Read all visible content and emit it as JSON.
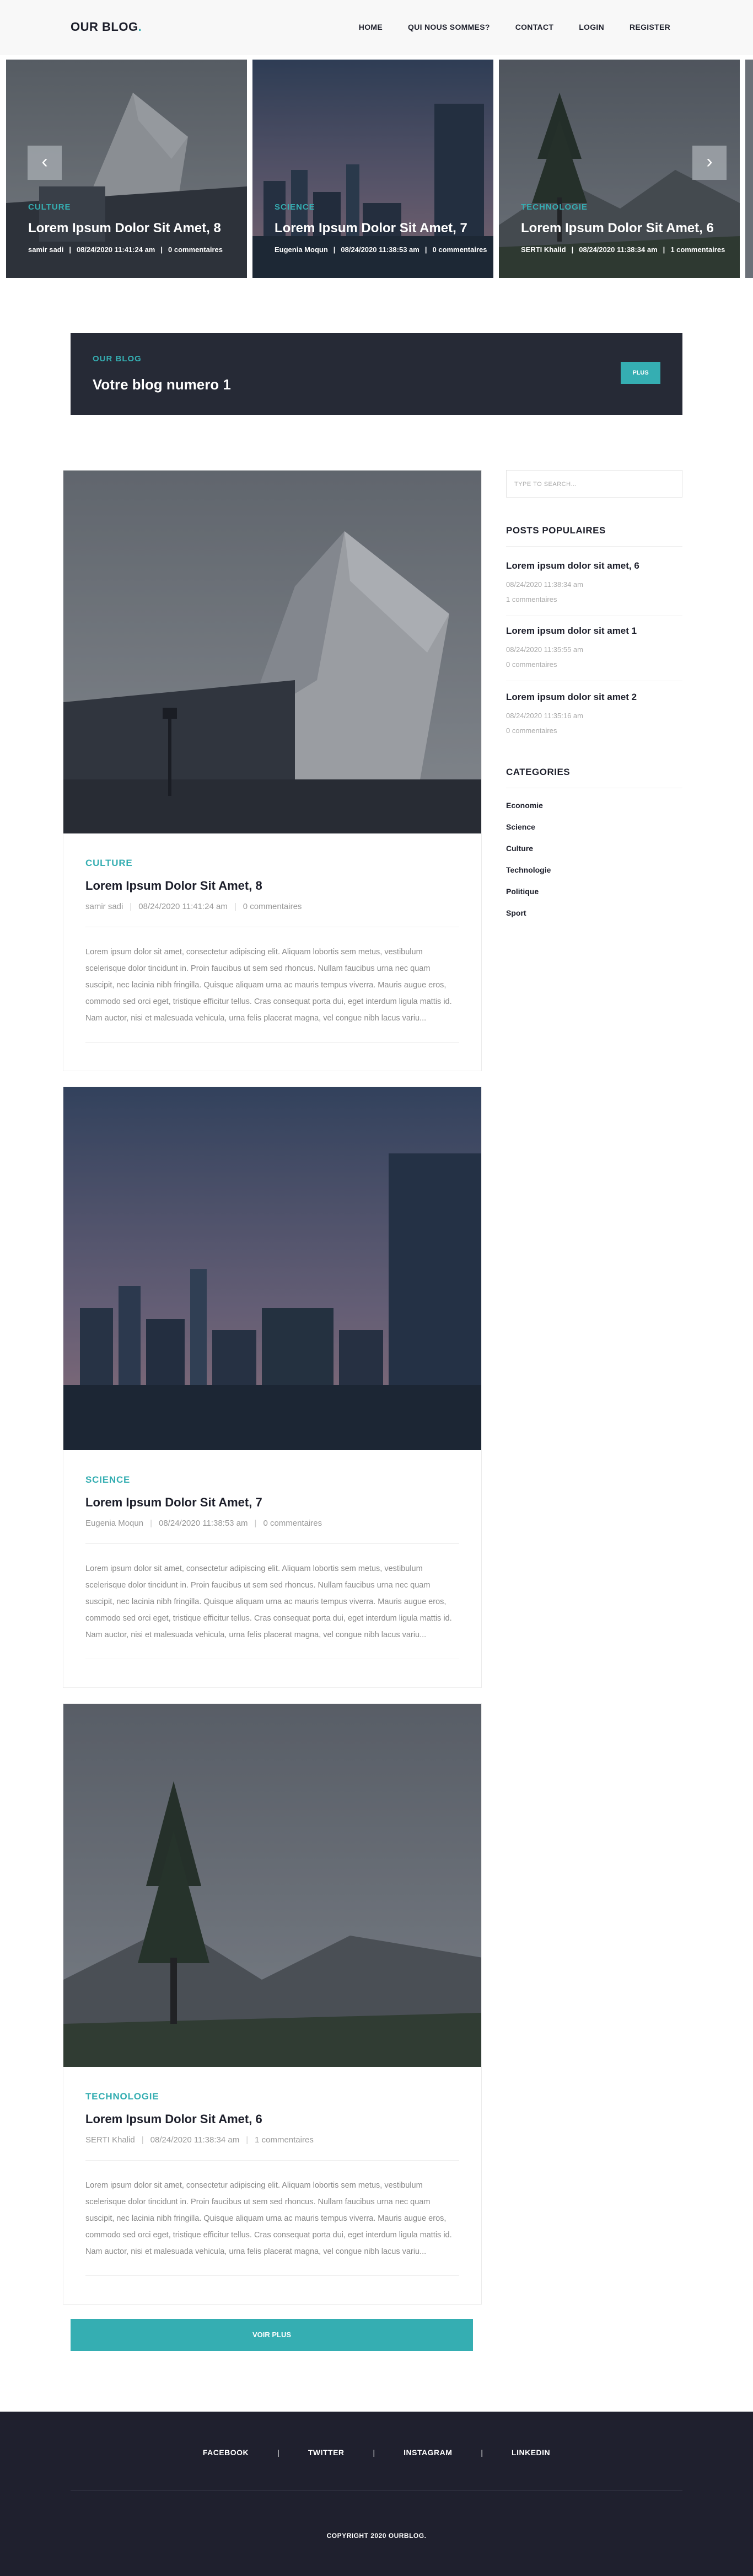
{
  "header": {
    "logo": "OUR BLOG",
    "logo_dot": ".",
    "nav": [
      "HOME",
      "QUI NOUS SOMMES?",
      "CONTACT",
      "LOGIN",
      "REGISTER"
    ]
  },
  "carousel": {
    "prev_icon": "‹",
    "next_icon": "›",
    "slides": [
      {
        "category": "CULTURE",
        "title": "Lorem Ipsum Dolor Sit Amet, 8",
        "author": "samir sadi",
        "date": "08/24/2020 11:41:24 am",
        "comments": "0 commentaires"
      },
      {
        "category": "SCIENCE",
        "title": "Lorem Ipsum Dolor Sit Amet, 7",
        "author": "Eugenia Moqun",
        "date": "08/24/2020 11:38:53 am",
        "comments": "0 commentaires"
      },
      {
        "category": "TECHNOLOGIE",
        "title": "Lorem Ipsum Dolor Sit Amet, 6",
        "author": "SERTI Khalid",
        "date": "08/24/2020 11:38:34 am",
        "comments": "1 commentaires"
      }
    ]
  },
  "banner": {
    "subtitle": "OUR BLOG",
    "title": "Votre blog numero 1",
    "button": "PLUS"
  },
  "posts": [
    {
      "category": "CULTURE",
      "title": "Lorem Ipsum Dolor Sit Amet, 8",
      "author": "samir sadi",
      "date": "08/24/2020 11:41:24 am",
      "comments": "0 commentaires",
      "excerpt": "Lorem ipsum dolor sit amet, consectetur adipiscing elit. Aliquam lobortis sem metus, vestibulum scelerisque dolor tincidunt in. Proin faucibus ut sem sed rhoncus. Nullam faucibus urna nec quam suscipit, nec lacinia nibh fringilla. Quisque aliquam urna ac mauris tempus viverra. Mauris augue eros, commodo sed orci eget, tristique efficitur tellus. Cras consequat porta dui, eget interdum ligula mattis id. Nam auctor, nisi et malesuada vehicula, urna felis placerat magna, vel congue nibh lacus variu..."
    },
    {
      "category": "SCIENCE",
      "title": "Lorem Ipsum Dolor Sit Amet, 7",
      "author": "Eugenia Moqun",
      "date": "08/24/2020 11:38:53 am",
      "comments": "0 commentaires",
      "excerpt": "Lorem ipsum dolor sit amet, consectetur adipiscing elit. Aliquam lobortis sem metus, vestibulum scelerisque dolor tincidunt in. Proin faucibus ut sem sed rhoncus. Nullam faucibus urna nec quam suscipit, nec lacinia nibh fringilla. Quisque aliquam urna ac mauris tempus viverra. Mauris augue eros, commodo sed orci eget, tristique efficitur tellus. Cras consequat porta dui, eget interdum ligula mattis id. Nam auctor, nisi et malesuada vehicula, urna felis placerat magna, vel congue nibh lacus variu..."
    },
    {
      "category": "TECHNOLOGIE",
      "title": "Lorem Ipsum Dolor Sit Amet, 6",
      "author": "SERTI Khalid",
      "date": "08/24/2020 11:38:34 am",
      "comments": "1 commentaires",
      "excerpt": "Lorem ipsum dolor sit amet, consectetur adipiscing elit. Aliquam lobortis sem metus, vestibulum scelerisque dolor tincidunt in. Proin faucibus ut sem sed rhoncus. Nullam faucibus urna nec quam suscipit, nec lacinia nibh fringilla. Quisque aliquam urna ac mauris tempus viverra. Mauris augue eros, commodo sed orci eget, tristique efficitur tellus. Cras consequat porta dui, eget interdum ligula mattis id. Nam auctor, nisi et malesuada vehicula, urna felis placerat magna, vel congue nibh lacus variu..."
    }
  ],
  "more_button": "VOIR PLUS",
  "sidebar": {
    "search_placeholder": "TYPE TO SEARCH...",
    "popular_heading": "POSTS POPULAIRES",
    "popular": [
      {
        "title": "Lorem ipsum dolor sit amet, 6",
        "date": "08/24/2020 11:38:34 am",
        "comments": "1 commentaires"
      },
      {
        "title": "Lorem ipsum dolor sit amet 1",
        "date": "08/24/2020 11:35:55 am",
        "comments": "0 commentaires"
      },
      {
        "title": "Lorem ipsum dolor sit amet 2",
        "date": "08/24/2020 11:35:16 am",
        "comments": "0 commentaires"
      }
    ],
    "categories_heading": "CATEGORIES",
    "categories": [
      "Economie",
      "Science",
      "Culture",
      "Technologie",
      "Politique",
      "Sport"
    ]
  },
  "footer": {
    "links": [
      "FACEBOOK",
      "TWITTER",
      "INSTAGRAM",
      "LINKEDIN"
    ],
    "separator": "|",
    "copyright": "COPYRIGHT 2020 OURBLOG."
  },
  "colors": {
    "accent": "#35aeb2",
    "dark": "#1d1f2b",
    "footer_bg": "#1f202e",
    "banner_bg": "#262a36"
  }
}
